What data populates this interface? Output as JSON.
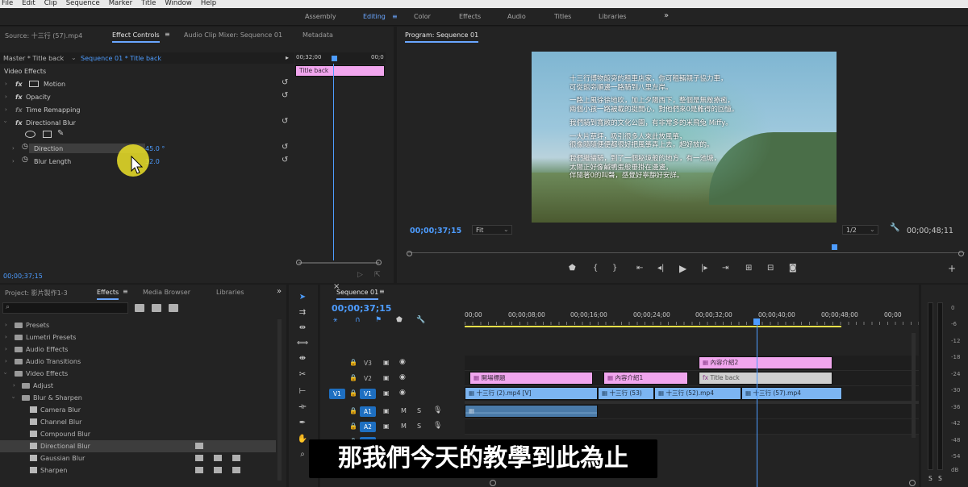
{
  "menu": [
    "File",
    "Edit",
    "Clip",
    "Sequence",
    "Marker",
    "Title",
    "Window",
    "Help"
  ],
  "workspaces": {
    "items": [
      "Assembly",
      "Editing",
      "Color",
      "Effects",
      "Audio",
      "Titles",
      "Libraries"
    ],
    "active": "Editing",
    "more": "»"
  },
  "source_panel": {
    "tabs": [
      "Source: 十三行 (57).mp4",
      "Effect Controls",
      "Audio Clip Mixer: Sequence 01",
      "Metadata"
    ],
    "master": "Master * Title back",
    "sequence": "Sequence 01 * Title back",
    "section": "Video Effects",
    "effects": [
      {
        "label": "Motion"
      },
      {
        "label": "Opacity"
      },
      {
        "label": "Time Remapping"
      },
      {
        "label": "Directional Blur"
      }
    ],
    "params": [
      {
        "label": "Direction",
        "value": "45.0 °"
      },
      {
        "label": "Blur Length",
        "value": "32.0"
      }
    ],
    "mini_ruler": {
      "start": "00;32;00",
      "end": "00;0"
    },
    "mini_clip": "Title back",
    "timecode": "00;00;37;15"
  },
  "program": {
    "title": "Program: Sequence 01",
    "timecode": "00;00;37;15",
    "fit": "Fit",
    "resolution": "1/2",
    "duration": "00;00;48;11",
    "subtitle_lines": [
      "十三行博物館旁的租車店家，你可租輛親子協力車，",
      "可從館旁順邊一路騎到八里左岸。",
      "",
      "一路上風徐徐地吹，加上夕陽西下，整個是無敵療癒，",
      "兩個小孩一路被載的挺開心，對他們來0是難得的回憶。",
      "",
      "我們騎到寬敞的文化公園，有非常多的米飛兔 Miffy。",
      "",
      "一大片草坪，吸引很多人來此放風箏，",
      "很像隨隨便便都很好把風箏弄上去，超好放的。",
      "",
      "我們繼續騎，到了一個秘境般的地方，有一池塘，",
      "太陽正好像鹹鴨蛋般垂掛在邊邊，",
      "伴隨著0的叫聲，感覺好寧靜好安詳。"
    ]
  },
  "project_panel": {
    "tabs": [
      "Project: 影片製作1-3",
      "Effects",
      "Media Browser",
      "Libraries"
    ],
    "more": "»",
    "tree": [
      {
        "label": "Presets",
        "type": "folder",
        "indent": 0,
        "open": false
      },
      {
        "label": "Lumetri Presets",
        "type": "folder",
        "indent": 0,
        "open": false
      },
      {
        "label": "Audio Effects",
        "type": "folder",
        "indent": 0,
        "open": false
      },
      {
        "label": "Audio Transitions",
        "type": "folder",
        "indent": 0,
        "open": false
      },
      {
        "label": "Video Effects",
        "type": "folder",
        "indent": 0,
        "open": true
      },
      {
        "label": "Adjust",
        "type": "folder",
        "indent": 1,
        "open": false
      },
      {
        "label": "Blur & Sharpen",
        "type": "folder",
        "indent": 1,
        "open": true
      },
      {
        "label": "Camera Blur",
        "type": "effect",
        "indent": 2
      },
      {
        "label": "Channel Blur",
        "type": "effect",
        "indent": 2
      },
      {
        "label": "Compound Blur",
        "type": "effect",
        "indent": 2
      },
      {
        "label": "Directional Blur",
        "type": "effect",
        "indent": 2,
        "selected": true
      },
      {
        "label": "Gaussian Blur",
        "type": "effect",
        "indent": 2
      },
      {
        "label": "Sharpen",
        "type": "effect",
        "indent": 2
      }
    ]
  },
  "timeline": {
    "tab": "Sequence 01",
    "timecode": "00;00;37;15",
    "ruler": [
      "00;00",
      "00;00;08;00",
      "00;00;16;00",
      "00;00;24;00",
      "00;00;32;00",
      "00;00;40;00",
      "00;00;48;00",
      "00;00"
    ],
    "tracks": [
      {
        "source": "",
        "name": "V3"
      },
      {
        "source": "",
        "name": "V2"
      },
      {
        "source": "V1",
        "name": "V1"
      },
      {
        "source": "",
        "name": "A1"
      },
      {
        "source": "",
        "name": "A2"
      }
    ],
    "track_buttons": {
      "mute": "M",
      "solo": "S"
    },
    "clips": {
      "v3": "內容介紹2",
      "v2_a": "開場標題",
      "v2_b": "內容介紹1",
      "v2_c": "Title back",
      "v1_a": "十三行 (2).mp4 [V]",
      "v1_b": "十三行 (53)",
      "v1_c": "十三行 (52).mp4",
      "v1_d": "十三行 (57).mp4"
    }
  },
  "meter": {
    "labels": [
      "0",
      "-6",
      "-12",
      "-18",
      "-24",
      "-30",
      "-36",
      "-42",
      "-48",
      "-54"
    ],
    "bottom": "dB",
    "solo": "S"
  },
  "caption": "那我們今天的教學到此為止"
}
